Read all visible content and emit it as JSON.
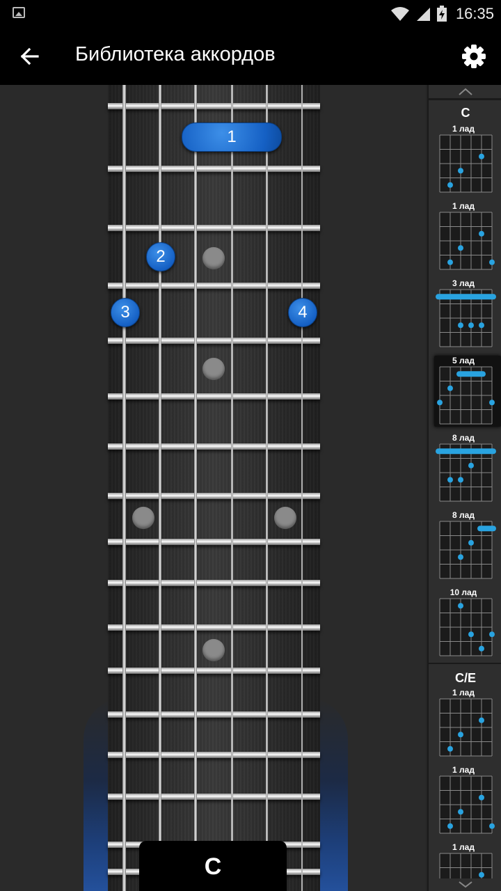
{
  "status_bar": {
    "time": "16:35"
  },
  "app_bar": {
    "title": "Библиотека аккордов",
    "back_icon": "arrow-left-icon",
    "settings_icon": "gear-icon"
  },
  "fretboard": {
    "chord_name": "C",
    "fingers": [
      {
        "label": "1",
        "type": "barre",
        "fret": 1
      },
      {
        "label": "2",
        "string": 2,
        "fret": 3
      },
      {
        "label": "3",
        "string": 1,
        "fret": 4
      },
      {
        "label": "4",
        "string": 6,
        "fret": 4
      }
    ],
    "accent_color": "#1566c9"
  },
  "chord_list": {
    "groups": [
      {
        "name": "C",
        "diagrams": [
          {
            "label": "1 лад",
            "selected": false
          },
          {
            "label": "1 лад",
            "selected": false
          },
          {
            "label": "3 лад",
            "selected": false
          },
          {
            "label": "5 лад",
            "selected": true
          },
          {
            "label": "8 лад",
            "selected": false
          },
          {
            "label": "8 лад",
            "selected": false
          },
          {
            "label": "10 лад",
            "selected": false
          }
        ]
      },
      {
        "name": "C/E",
        "diagrams": [
          {
            "label": "1 лад",
            "selected": false
          },
          {
            "label": "1 лад",
            "selected": false
          },
          {
            "label": "1 лад",
            "selected": false
          }
        ]
      }
    ],
    "dot_color": "#29a3e0"
  }
}
